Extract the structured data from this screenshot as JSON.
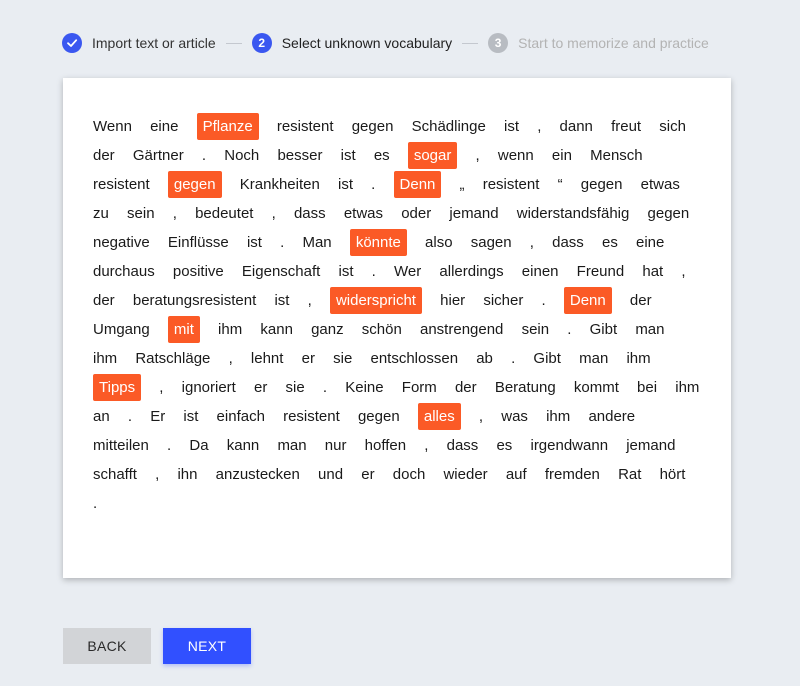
{
  "stepper": {
    "steps": [
      {
        "label": "Import text or article",
        "status": "done",
        "number": "1"
      },
      {
        "label": "Select unknown vocabulary",
        "status": "active",
        "number": "2"
      },
      {
        "label": "Start to memorize and practice",
        "status": "pending",
        "number": "3"
      }
    ]
  },
  "text": {
    "tokens": [
      {
        "t": "Wenn"
      },
      {
        "t": "eine"
      },
      {
        "t": "Pflanze",
        "s": true
      },
      {
        "t": "resistent"
      },
      {
        "t": "gegen"
      },
      {
        "t": "Schädlinge"
      },
      {
        "t": "ist"
      },
      {
        "t": ","
      },
      {
        "t": "dann"
      },
      {
        "t": "freut"
      },
      {
        "t": "sich"
      },
      {
        "t": "der"
      },
      {
        "t": "Gärtner"
      },
      {
        "t": "."
      },
      {
        "t": "Noch"
      },
      {
        "t": "besser"
      },
      {
        "t": "ist"
      },
      {
        "t": "es"
      },
      {
        "t": "sogar",
        "s": true
      },
      {
        "t": ","
      },
      {
        "t": "wenn"
      },
      {
        "t": "ein"
      },
      {
        "t": "Mensch"
      },
      {
        "t": "resistent"
      },
      {
        "t": "gegen",
        "s": true
      },
      {
        "t": "Krankheiten"
      },
      {
        "t": "ist"
      },
      {
        "t": "."
      },
      {
        "t": "Denn",
        "s": true
      },
      {
        "t": "„"
      },
      {
        "t": "resistent"
      },
      {
        "t": "“"
      },
      {
        "t": "gegen"
      },
      {
        "t": "etwas"
      },
      {
        "t": "zu"
      },
      {
        "t": "sein"
      },
      {
        "t": ","
      },
      {
        "t": "bedeutet"
      },
      {
        "t": ","
      },
      {
        "t": "dass"
      },
      {
        "t": "etwas"
      },
      {
        "t": "oder"
      },
      {
        "t": "jemand"
      },
      {
        "t": "widerstandsfähig"
      },
      {
        "t": "gegen"
      },
      {
        "t": "negative"
      },
      {
        "t": "Einflüsse"
      },
      {
        "t": "ist"
      },
      {
        "t": "."
      },
      {
        "t": "Man"
      },
      {
        "t": "könnte",
        "s": true
      },
      {
        "t": "also"
      },
      {
        "t": "sagen"
      },
      {
        "t": ","
      },
      {
        "t": "dass"
      },
      {
        "t": "es"
      },
      {
        "t": "eine"
      },
      {
        "t": "durchaus"
      },
      {
        "t": "positive"
      },
      {
        "t": "Eigenschaft"
      },
      {
        "t": "ist"
      },
      {
        "t": "."
      },
      {
        "t": "Wer"
      },
      {
        "t": "allerdings"
      },
      {
        "t": "einen"
      },
      {
        "t": "Freund"
      },
      {
        "t": "hat"
      },
      {
        "t": ","
      },
      {
        "t": "der"
      },
      {
        "t": "beratungsresistent"
      },
      {
        "t": "ist"
      },
      {
        "t": ","
      },
      {
        "t": "widerspricht",
        "s": true
      },
      {
        "t": "hier"
      },
      {
        "t": "sicher"
      },
      {
        "t": "."
      },
      {
        "t": "Denn",
        "s": true
      },
      {
        "t": "der"
      },
      {
        "t": "Umgang"
      },
      {
        "t": "mit",
        "s": true
      },
      {
        "t": "ihm"
      },
      {
        "t": "kann"
      },
      {
        "t": "ganz"
      },
      {
        "t": "schön"
      },
      {
        "t": "anstrengend"
      },
      {
        "t": "sein"
      },
      {
        "t": "."
      },
      {
        "t": "Gibt"
      },
      {
        "t": "man"
      },
      {
        "t": "ihm"
      },
      {
        "t": "Ratschläge"
      },
      {
        "t": ","
      },
      {
        "t": "lehnt"
      },
      {
        "t": "er"
      },
      {
        "t": "sie"
      },
      {
        "t": "entschlossen"
      },
      {
        "t": "ab"
      },
      {
        "t": "."
      },
      {
        "t": "Gibt"
      },
      {
        "t": "man"
      },
      {
        "t": "ihm"
      },
      {
        "t": "Tipps",
        "s": true
      },
      {
        "t": ","
      },
      {
        "t": "ignoriert"
      },
      {
        "t": "er"
      },
      {
        "t": "sie"
      },
      {
        "t": "."
      },
      {
        "t": "Keine"
      },
      {
        "t": "Form"
      },
      {
        "t": "der"
      },
      {
        "t": "Beratung"
      },
      {
        "t": "kommt"
      },
      {
        "t": "bei"
      },
      {
        "t": "ihm"
      },
      {
        "t": "an"
      },
      {
        "t": "."
      },
      {
        "t": "Er"
      },
      {
        "t": "ist"
      },
      {
        "t": "einfach"
      },
      {
        "t": "resistent"
      },
      {
        "t": "gegen"
      },
      {
        "t": "alles",
        "s": true
      },
      {
        "t": ","
      },
      {
        "t": "was"
      },
      {
        "t": "ihm"
      },
      {
        "t": "andere"
      },
      {
        "t": "mitteilen"
      },
      {
        "t": "."
      },
      {
        "t": "Da"
      },
      {
        "t": "kann"
      },
      {
        "t": "man"
      },
      {
        "t": "nur"
      },
      {
        "t": "hoffen"
      },
      {
        "t": ","
      },
      {
        "t": "dass"
      },
      {
        "t": "es"
      },
      {
        "t": "irgendwann"
      },
      {
        "t": "jemand"
      },
      {
        "t": "schafft"
      },
      {
        "t": ","
      },
      {
        "t": "ihn"
      },
      {
        "t": "anzustecken"
      },
      {
        "t": "und"
      },
      {
        "t": "er"
      },
      {
        "t": "doch"
      },
      {
        "t": "wieder"
      },
      {
        "t": "auf"
      },
      {
        "t": "fremden"
      },
      {
        "t": "Rat"
      },
      {
        "t": "hört"
      },
      {
        "t": "."
      }
    ]
  },
  "buttons": {
    "back_label": "BACK",
    "next_label": "NEXT"
  },
  "colors": {
    "accent": "#3150ff",
    "highlight": "#fb5a26"
  }
}
